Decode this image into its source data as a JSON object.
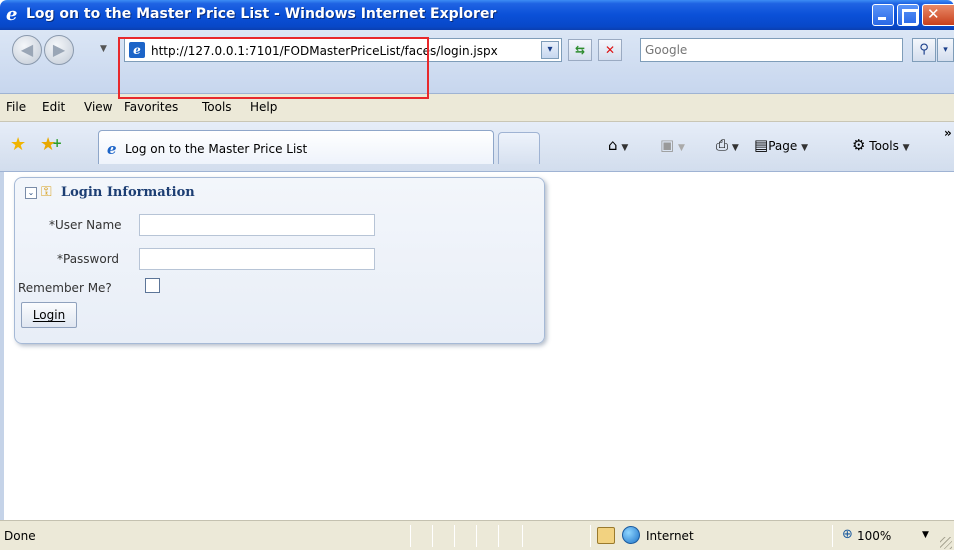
{
  "window": {
    "title": "Log on to the Master Price List - Windows Internet Explorer",
    "icon": "ie-logo-icon"
  },
  "address_bar": {
    "url": "http://127.0.0.1:7101/FODMasterPriceList/faces/login.jspx",
    "search_placeholder": "Google"
  },
  "menu": {
    "items": [
      "File",
      "Edit",
      "View",
      "Favorites",
      "Tools",
      "Help"
    ]
  },
  "tabs": {
    "active_label": "Log on to the Master Price List"
  },
  "command_bar": {
    "page_label": "Page",
    "tools_label": "Tools",
    "overflow": "»"
  },
  "login_panel": {
    "title": "Login Information",
    "username_label": "User Name",
    "password_label": "Password",
    "remember_label": "Remember Me?",
    "required_marker": "*",
    "login_button": "Login",
    "username_value": "",
    "password_value": ""
  },
  "status_bar": {
    "status": "Done",
    "zone": "Internet",
    "zoom": "100%"
  },
  "colors": {
    "titlebar": "#0a50d8",
    "panel_title": "#1d3e73",
    "highlight": "#e8292c"
  }
}
